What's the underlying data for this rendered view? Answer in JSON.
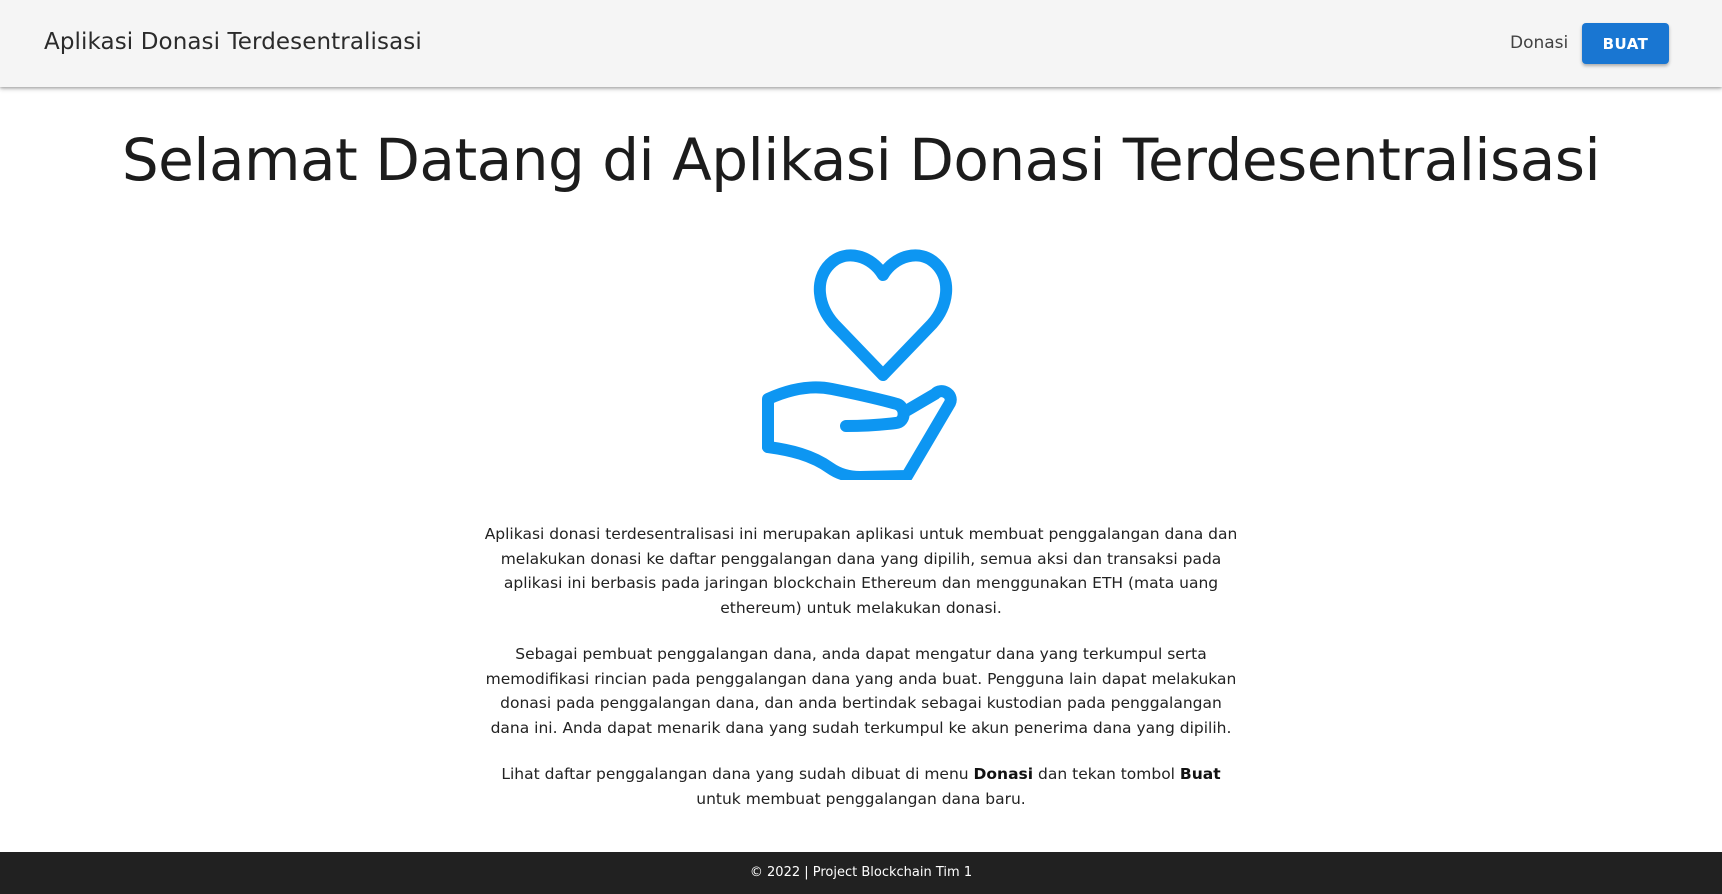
{
  "navbar": {
    "brand": "Aplikasi Donasi Terdesentralisasi",
    "link_donasi": "Donasi",
    "button_buat": "BUAT"
  },
  "main": {
    "title": "Selamat Datang di Aplikasi Donasi Terdesentralisasi",
    "icon": "heart-hand-icon",
    "paragraph1": "Aplikasi donasi terdesentralisasi ini merupakan aplikasi untuk membuat penggalangan dana dan melakukan donasi ke daftar penggalangan dana yang dipilih, semua aksi dan transaksi pada aplikasi ini berbasis pada jaringan blockchain Ethereum dan menggunakan ETH (mata uang ethereum) untuk melakukan donasi.",
    "paragraph2": "Sebagai pembuat penggalangan dana, anda dapat mengatur dana yang terkumpul serta memodifikasi rincian pada penggalangan dana yang anda buat. Pengguna lain dapat melakukan donasi pada penggalangan dana, dan anda bertindak sebagai kustodian pada penggalangan dana ini. Anda dapat menarik dana yang sudah terkumpul ke akun penerima dana yang dipilih.",
    "paragraph3": {
      "part1": "Lihat daftar penggalangan dana yang sudah dibuat di menu ",
      "bold1": "Donasi",
      "part2": " dan tekan tombol ",
      "bold2": "Buat",
      "part3": " untuk membuat penggalangan dana baru."
    }
  },
  "footer": {
    "text": "© 2022 | Project Blockchain Tim 1"
  },
  "colors": {
    "primary_button": "#1976d2",
    "icon_blue": "#0d96f2",
    "navbar_bg": "#f5f5f5",
    "footer_bg": "#212121"
  }
}
